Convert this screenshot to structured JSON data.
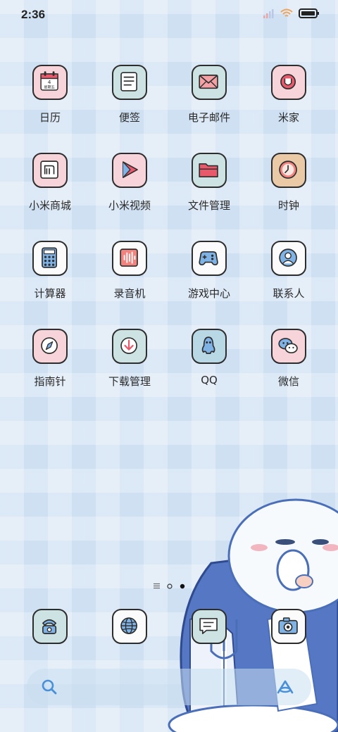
{
  "status_bar": {
    "time": "2:36"
  },
  "apps": [
    {
      "label": "日历",
      "icon": "calendar-icon",
      "bg": "pink"
    },
    {
      "label": "便签",
      "icon": "notes-icon",
      "bg": "mint"
    },
    {
      "label": "电子邮件",
      "icon": "mail-icon",
      "bg": "mint"
    },
    {
      "label": "米家",
      "icon": "mijia-icon",
      "bg": "pink"
    },
    {
      "label": "小米商城",
      "icon": "mi-store-icon",
      "bg": "pink"
    },
    {
      "label": "小米视频",
      "icon": "video-play-icon",
      "bg": "pink"
    },
    {
      "label": "文件管理",
      "icon": "folder-icon",
      "bg": "mint"
    },
    {
      "label": "时钟",
      "icon": "clock-icon",
      "bg": "tan"
    },
    {
      "label": "计算器",
      "icon": "calculator-icon",
      "bg": "white"
    },
    {
      "label": "录音机",
      "icon": "recorder-icon",
      "bg": "white"
    },
    {
      "label": "游戏中心",
      "icon": "gamepad-icon",
      "bg": "white"
    },
    {
      "label": "联系人",
      "icon": "contacts-icon",
      "bg": "white"
    },
    {
      "label": "指南针",
      "icon": "compass-icon",
      "bg": "pink"
    },
    {
      "label": "下载管理",
      "icon": "download-icon",
      "bg": "mint"
    },
    {
      "label": "QQ",
      "icon": "qq-penguin-icon",
      "bg": "blue"
    },
    {
      "label": "微信",
      "icon": "wechat-icon",
      "bg": "pink"
    }
  ],
  "calendar_icon_text": {
    "day": "4",
    "weekday": "星期五"
  },
  "dock": [
    {
      "icon": "phone-icon"
    },
    {
      "icon": "browser-globe-icon"
    },
    {
      "icon": "messages-icon"
    },
    {
      "icon": "camera-icon"
    }
  ],
  "search_bar": {
    "left_icon": "search-icon",
    "right_icon": "assistant-icon"
  },
  "colors": {
    "background": "#cfe0f2",
    "icon_pink": "#f7d4d9",
    "icon_mint": "#cde3e3",
    "accent_blue": "#4a90d9"
  }
}
